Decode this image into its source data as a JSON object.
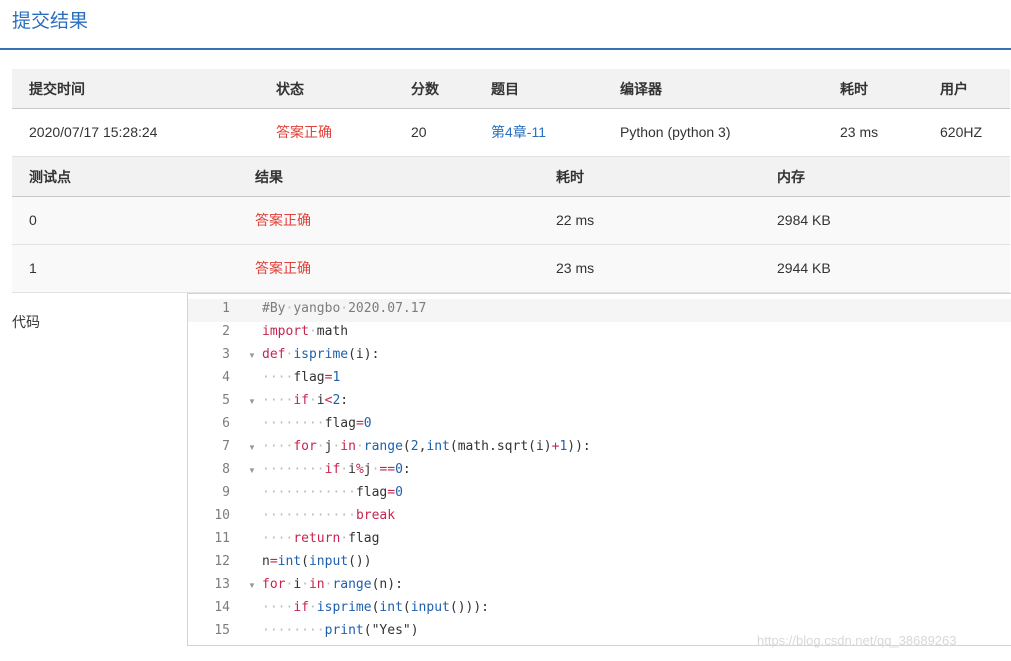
{
  "page_title": "提交结果",
  "summary": {
    "headers": [
      "提交时间",
      "状态",
      "分数",
      "题目",
      "编译器",
      "耗时",
      "用户"
    ],
    "row": {
      "time": "2020/07/17 15:28:24",
      "status": "答案正确",
      "score": "20",
      "problem": "第4章-11",
      "compiler": "Python (python 3)",
      "elapsed": "23 ms",
      "user": "620HZ"
    }
  },
  "tests": {
    "headers": [
      "测试点",
      "结果",
      "耗时",
      "内存"
    ],
    "rows": [
      {
        "id": "0",
        "result": "答案正确",
        "time": "22 ms",
        "memory": "2984 KB"
      },
      {
        "id": "1",
        "result": "答案正确",
        "time": "23 ms",
        "memory": "2944 KB"
      }
    ]
  },
  "code_label": "代码",
  "code": {
    "line_numbers": [
      "1",
      "2",
      "3",
      "4",
      "5",
      "6",
      "7",
      "8",
      "9",
      "10",
      "11",
      "12",
      "13",
      "14",
      "15"
    ],
    "lines": [
      "#By·yangbo·2020.07.17",
      "import·math",
      "def·isprime(i):",
      "····flag=1",
      "····if·i<2:",
      "········flag=0",
      "····for·j·in·range(2,int(math.sqrt(i)+1)):",
      "········if·i%j·==0:",
      "············flag=0",
      "············break",
      "····return·flag",
      "n=int(input())",
      "for·i·in·range(n):",
      "····if·isprime(int(input())):",
      "········print(\"Yes\")"
    ]
  },
  "watermark": "https://blog.csdn.net/qq_38689263"
}
